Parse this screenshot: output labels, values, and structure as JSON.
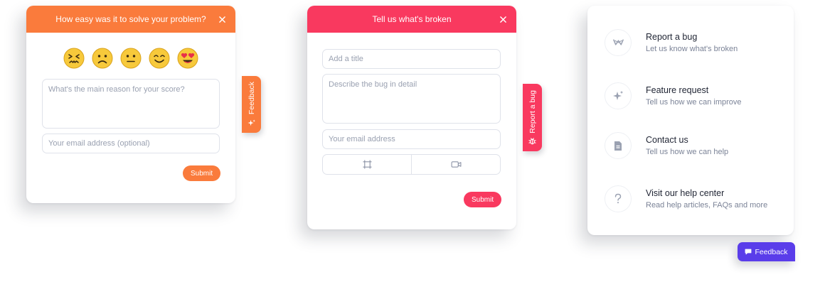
{
  "rating_widget": {
    "title": "How easy was it to solve your problem?",
    "emojis": [
      "confounded-face",
      "slightly-frowning-face",
      "neutral-face",
      "smiling-face",
      "heart-eyes-face"
    ],
    "reason_placeholder": "What's the main reason for your score?",
    "email_placeholder": "Your email address (optional)",
    "submit_label": "Submit",
    "accent_color": "#fa7b3c"
  },
  "feedback_tab": {
    "label": "Feedback",
    "icon": "sparkles-icon"
  },
  "bug_widget": {
    "title": "Tell us what's broken",
    "title_placeholder": "Add a title",
    "description_placeholder": "Describe the bug in detail",
    "email_placeholder": "Your email address",
    "capture_buttons": [
      "screenshot-crop-icon",
      "video-camera-icon"
    ],
    "submit_label": "Submit",
    "accent_color": "#f9395f"
  },
  "bug_tab": {
    "label": "Report a bug",
    "icon": "bug-icon"
  },
  "menu_widget": {
    "items": [
      {
        "icon": "bug-icon",
        "title": "Report a bug",
        "subtitle": "Let us know what's broken"
      },
      {
        "icon": "sparkles-icon",
        "title": "Feature request",
        "subtitle": "Tell us how we can improve"
      },
      {
        "icon": "document-icon",
        "title": "Contact us",
        "subtitle": "Tell us how we can help"
      },
      {
        "icon": "question-icon",
        "title": "Visit our help center",
        "subtitle": "Read help articles, FAQs and more"
      }
    ]
  },
  "feedback_launcher": {
    "label": "Feedback",
    "icon": "chat-bubble-icon",
    "accent_color": "#5a3dea"
  }
}
